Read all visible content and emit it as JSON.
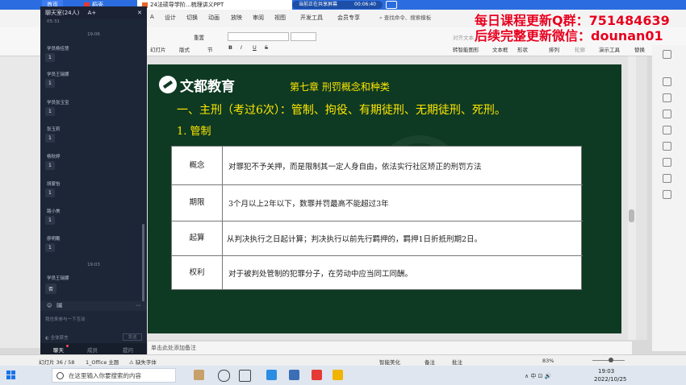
{
  "titlebar": {
    "tabs": [
      "首页",
      "稻壳",
      "24法硕导学阶...梳理讲义PPT"
    ],
    "share_text": "当前正在共享屏幕",
    "share_time": "00:06:40"
  },
  "menu": {
    "items": [
      "A",
      "设计",
      "切换",
      "动画",
      "放映",
      "审阅",
      "视图",
      "开发工具",
      "会员专享"
    ],
    "search": "查找命令、搜索模板"
  },
  "ribbon": {
    "left1": "重置",
    "left2": "幻灯片",
    "left3": "版式",
    "left4": "节",
    "bold": "B",
    "italic": "I",
    "underline": "U",
    "strike": "S",
    "right1": "对齐文本",
    "right2": "转智能图形",
    "textbox": "文本框",
    "shape": "形状",
    "arrange": "排列",
    "outline": "轮廓",
    "play_tool": "演示工具",
    "replace": "替换"
  },
  "promo": {
    "line1": "每日课程更新Q群：751484639",
    "line2": "后续完整更新微信：dounan01"
  },
  "chat": {
    "title": "聊天室(24人)",
    "font_btn": "A+",
    "first_partial": "05:31",
    "entries": [
      {
        "type": "time",
        "text": "19:06"
      },
      {
        "type": "msg",
        "name": "学员杨佳慧",
        "text": "1"
      },
      {
        "type": "msg",
        "name": "学员王瑞娜",
        "text": "1"
      },
      {
        "type": "msg",
        "name": "学员张玉宝",
        "text": "1"
      },
      {
        "type": "msg",
        "name": "张玉莉",
        "text": "1"
      },
      {
        "type": "msg",
        "name": "杨秋婷",
        "text": "1"
      },
      {
        "type": "msg",
        "name": "胡蒙怡",
        "text": "1"
      },
      {
        "type": "msg",
        "name": "路小美",
        "text": "1"
      },
      {
        "type": "msg",
        "name": "廖明戴",
        "text": "1"
      },
      {
        "type": "time",
        "text": "19:03"
      },
      {
        "type": "msg",
        "name": "学员王瑞娜",
        "text": "否"
      }
    ],
    "input_emoji": "☺",
    "input_label": "🖼",
    "placeholder": "我也来参与一下互动",
    "all_mute": "全体禁言",
    "send": "发送",
    "tabs": [
      "聊天",
      "成员",
      "提问"
    ]
  },
  "slide": {
    "logo": "文都教育",
    "chapter": "第七章  刑罚概念和种类",
    "heading": "一、主刑（考过6次）：管制、拘役、有期徒刑、无期徒刑、死刑。",
    "subheading": "1. 管制",
    "table": [
      {
        "key": "概念",
        "value": "对罪犯不予关押，而是限制其一定人身自由，依法实行社区矫正的刑罚方法"
      },
      {
        "key": "期限",
        "value": "3个月以上2年以下，数罪并罚最高不能超过3年"
      },
      {
        "key": "起算",
        "value": "从判决执行之日起计算；判决执行以前先行羁押的，羁押1日折抵刑期2日。"
      },
      {
        "key": "权利",
        "value": "对于被判处管制的犯罪分子，在劳动中应当同工同酬。"
      }
    ]
  },
  "notes": "单击此处添加备注",
  "status": {
    "slide_info": "幻灯片 36 / 58",
    "theme": "1_Office 主题",
    "font_missing": "缺失字体",
    "beautify": "智能美化",
    "notes_btn": "备注",
    "comment": "批注",
    "zoom": "83%"
  },
  "taskbar": {
    "search_placeholder": "在这里输入你要搜索的内容",
    "tray": "∧  中  ⊡  🔊",
    "time": "19:03",
    "date": "2022/10/25"
  },
  "colors": {
    "accent": "#2b6de0",
    "slide_bg": "#0e3a23",
    "slide_yellow": "#ffe600",
    "promo_red": "#e6001e"
  }
}
